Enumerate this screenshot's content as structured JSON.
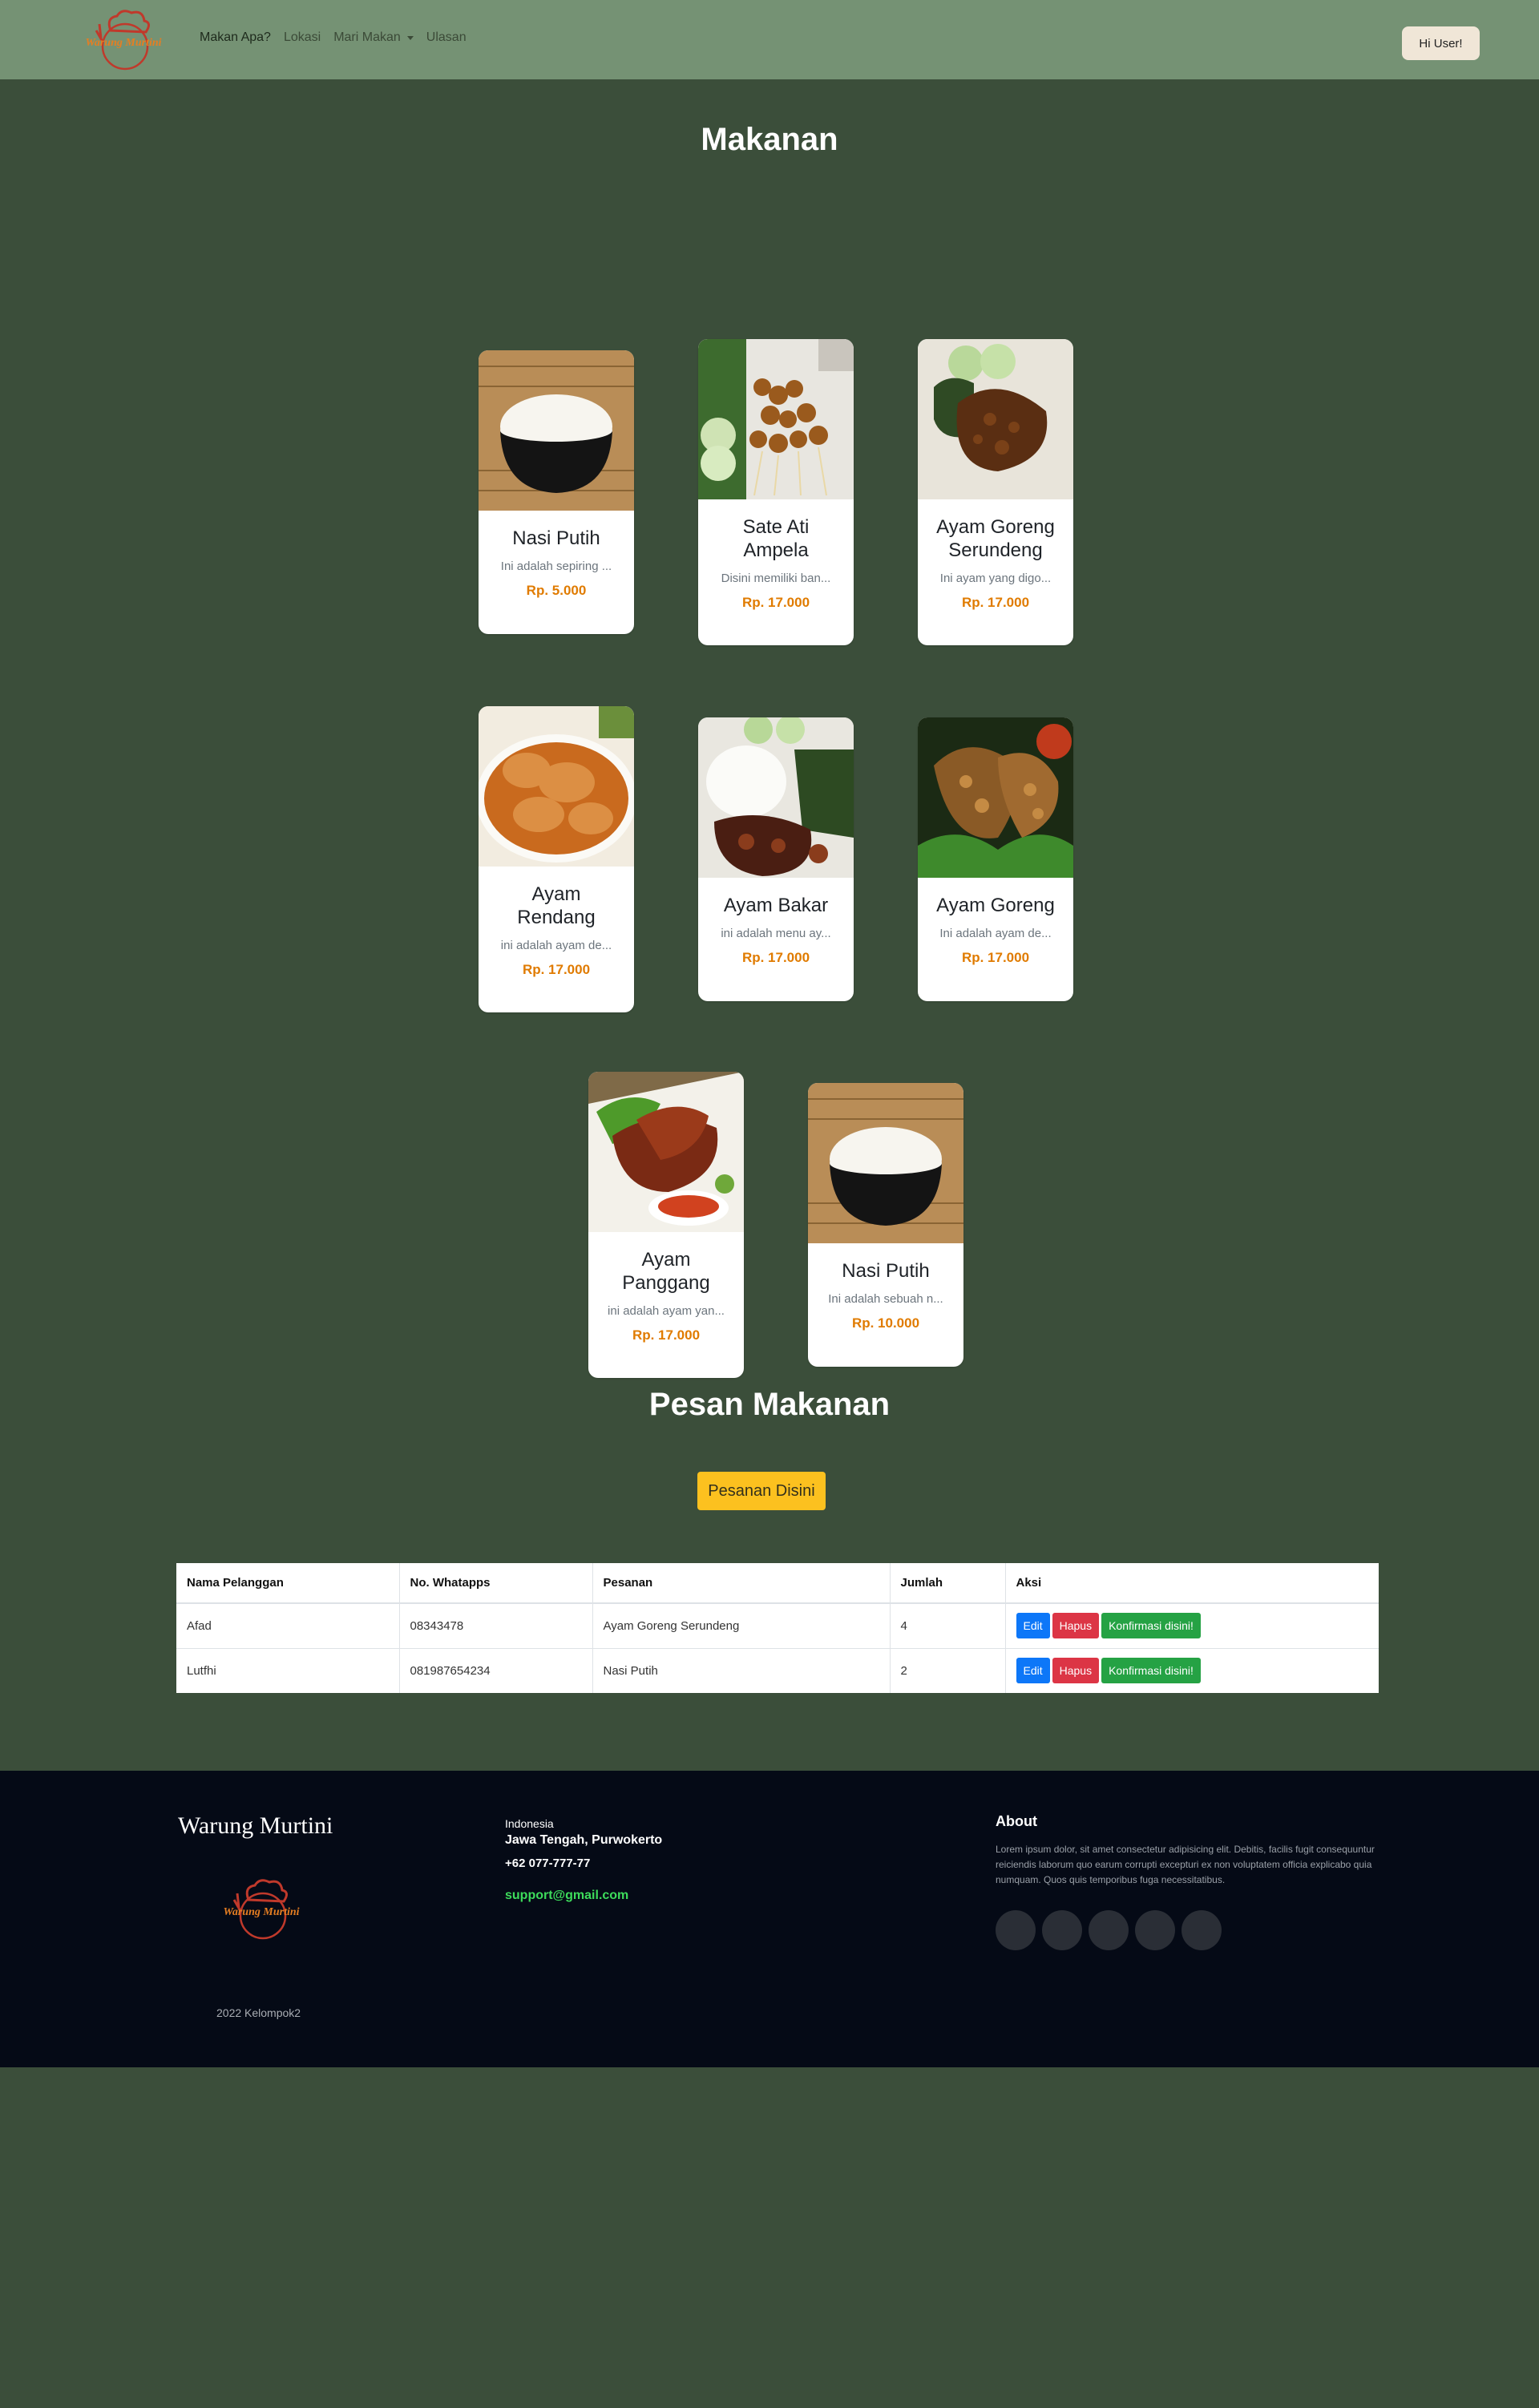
{
  "navbar": {
    "logo_text": "Warung Murtini",
    "links": [
      {
        "label": "Makan Apa?"
      },
      {
        "label": "Lokasi"
      },
      {
        "label": "Mari Makan"
      },
      {
        "label": "Ulasan"
      }
    ],
    "user_button": "Hi User!"
  },
  "makanan": {
    "title": "Makanan",
    "items": [
      {
        "name": "Nasi Putih",
        "desc": "Ini adalah sepiring ...",
        "price": "Rp. 5.000",
        "image": "rice-bowl"
      },
      {
        "name": "Sate Ati Ampela",
        "desc": "Disini memiliki ban...",
        "price": "Rp. 17.000",
        "image": "satay"
      },
      {
        "name": "Ayam Goreng Serundeng",
        "desc": "Ini ayam yang digo...",
        "price": "Rp. 17.000",
        "image": "fried-chicken-serundeng"
      },
      {
        "name": "Ayam Rendang",
        "desc": "ini adalah ayam de...",
        "price": "Rp. 17.000",
        "image": "rendang-chicken"
      },
      {
        "name": "Ayam Bakar",
        "desc": "ini adalah menu ay...",
        "price": "Rp. 17.000",
        "image": "grilled-chicken-plate"
      },
      {
        "name": "Ayam Goreng",
        "desc": "Ini adalah ayam de...",
        "price": "Rp. 17.000",
        "image": "fried-chicken"
      },
      {
        "name": "Ayam Panggang",
        "desc": "ini adalah ayam yan...",
        "price": "Rp. 17.000",
        "image": "roast-chicken-sambal"
      },
      {
        "name": "Nasi Putih",
        "desc": "Ini adalah sebuah n...",
        "price": "Rp. 10.000",
        "image": "rice-bowl"
      }
    ]
  },
  "pesan": {
    "title": "Pesan Makanan",
    "button": "Pesanan Disini"
  },
  "table": {
    "headers": [
      "Nama Pelanggan",
      "No. Whatapps",
      "Pesanan",
      "Jumlah",
      "Aksi"
    ],
    "rows": [
      {
        "nama": "Afad",
        "whatsapp": "08343478",
        "pesanan": "Ayam Goreng Serundeng",
        "jumlah": "4"
      },
      {
        "nama": "Lutfhi",
        "whatsapp": "081987654234",
        "pesanan": "Nasi Putih",
        "jumlah": "2"
      }
    ],
    "actions": {
      "edit": "Edit",
      "hapus": "Hapus",
      "konfirmasi": "Konfirmasi disini!"
    }
  },
  "footer": {
    "brand": "Warung Murtini",
    "logo_text": "Warung Murtini",
    "country": "Indonesia",
    "region": "Jawa Tengah, Purwokerto",
    "phone": "+62 077-777-77",
    "email": "support@gmail.com",
    "about_title": "About",
    "about_text": "Lorem ipsum dolor, sit amet consectetur adipisicing elit. Debitis, facilis fugit consequuntur reiciendis laborum quo earum corrupti excepturi ex non voluptatem officia explicabo quia numquam. Quos quis temporibus fuga necessitatibus.",
    "copyright": "2022 Kelompok2"
  },
  "colors": {
    "navbar_bg": "#759274",
    "page_bg": "#3b4e3a",
    "footer_bg": "#050a16",
    "price": "#e07b00",
    "order_button": "#fcc11f",
    "edit": "#0d77f8",
    "hapus": "#dc3545",
    "konfirmasi": "#25a244",
    "email": "#3ddc5b"
  }
}
